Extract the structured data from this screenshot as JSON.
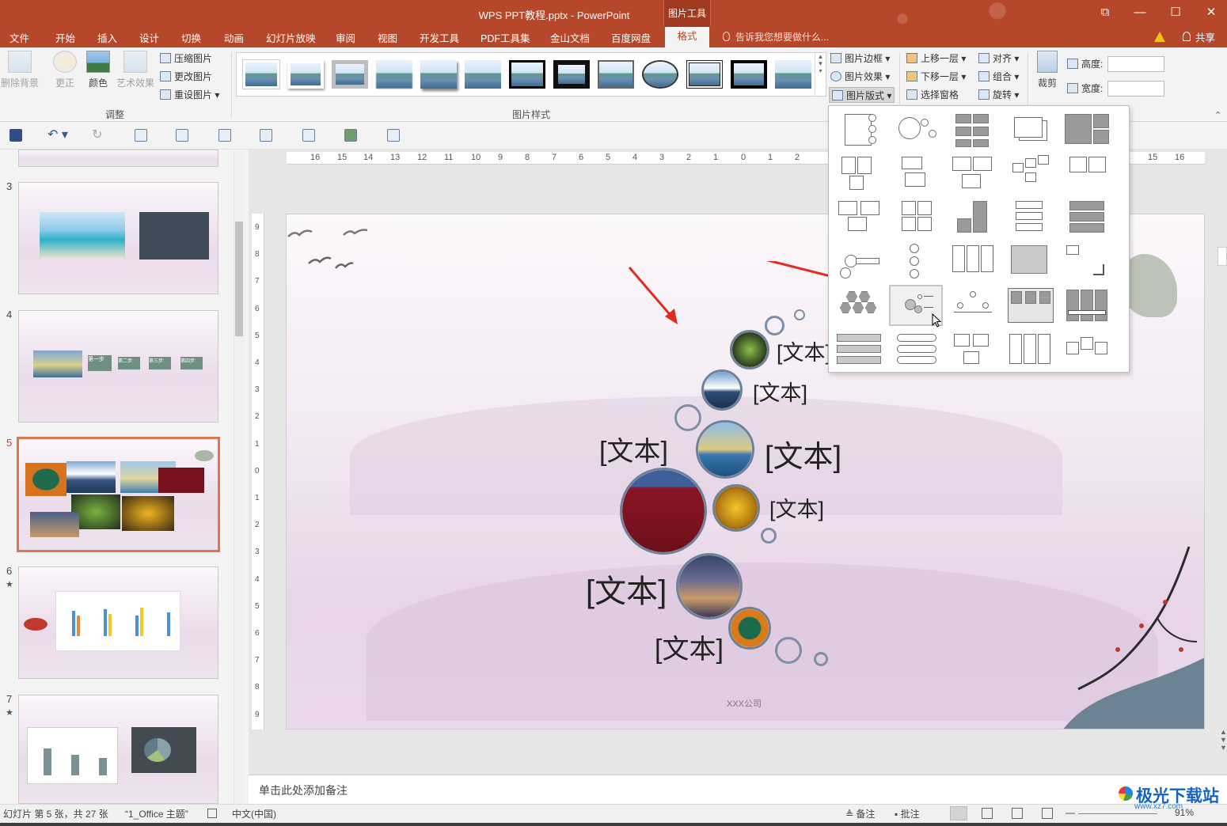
{
  "window": {
    "title": "WPS PPT教程.pptx - PowerPoint",
    "context_group": "图片工具",
    "controls": [
      "⧉",
      "—",
      "☐",
      "✕"
    ]
  },
  "tabs": [
    "文件",
    "开始",
    "插入",
    "设计",
    "切换",
    "动画",
    "幻灯片放映",
    "审阅",
    "视图",
    "开发工具",
    "PDF工具集",
    "金山文档",
    "百度网盘"
  ],
  "active_tab": "格式",
  "tell_me": "告诉我您想要做什么...",
  "share": "共享",
  "ribbon": {
    "adjust": {
      "remove_bg": "删除背景",
      "correct": "更正",
      "color": "颜色",
      "art_effect": "艺术效果",
      "compress": "压缩图片",
      "change": "更改图片",
      "reset": "重设图片",
      "group_label": "调整"
    },
    "styles": {
      "group_label": "图片样式"
    },
    "picture_cmds": {
      "border": "图片边框",
      "effect": "图片效果",
      "layout": "图片版式"
    },
    "arrange": {
      "bring_forward": "上移一层",
      "send_backward": "下移一层",
      "selection_pane": "选择窗格",
      "align": "对齐",
      "group": "组合",
      "rotate": "旋转"
    },
    "size": {
      "crop": "裁剪",
      "height": "高度:",
      "width": "宽度:"
    }
  },
  "slides": [
    {
      "num": "3",
      "star": ""
    },
    {
      "num": "4",
      "star": ""
    },
    {
      "num": "5",
      "star": ""
    },
    {
      "num": "6",
      "star": "★"
    },
    {
      "num": "7",
      "star": "★"
    }
  ],
  "slide4_steps": [
    "第一步",
    "第二步:",
    "第三步:",
    "第四步:"
  ],
  "ruler": {
    "h": [
      "16",
      "15",
      "14",
      "13",
      "12",
      "11",
      "10",
      "9",
      "8",
      "7",
      "6",
      "5",
      "4",
      "3",
      "2",
      "1",
      "0",
      "1",
      "2",
      "15",
      "16"
    ],
    "v": [
      "9",
      "8",
      "7",
      "6",
      "5",
      "4",
      "3",
      "2",
      "1",
      "0",
      "1",
      "2",
      "3",
      "4",
      "5",
      "6",
      "7",
      "8",
      "9"
    ]
  },
  "slide_content": {
    "label": "[文本]",
    "company": "XXX公司"
  },
  "notes_placeholder": "单击此处添加备注",
  "status": {
    "slide_info": "幻灯片 第 5 张，共 27 张",
    "theme": "“1_Office 主题”",
    "language": "中文(中国)",
    "notes": "备注",
    "comments": "批注",
    "zoom": "91%"
  },
  "watermark": {
    "main": "极光下载站",
    "sub": "www.xz7.com"
  }
}
